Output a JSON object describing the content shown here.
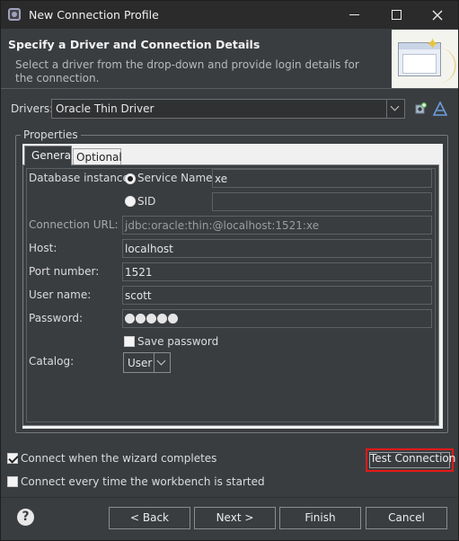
{
  "window": {
    "title": "New Connection Profile"
  },
  "header": {
    "title": "Specify a Driver and Connection Details",
    "description": "Select a driver from the drop-down and provide login details for the connection."
  },
  "drivers": {
    "label": "Drivers:",
    "selected": "Oracle Thin Driver",
    "new_icon": "new-driver-icon",
    "edit_icon": "edit-driver-icon"
  },
  "properties": {
    "legend": "Properties",
    "tabs": [
      {
        "label": "General",
        "active": true
      },
      {
        "label": "Optional",
        "active": false
      }
    ],
    "general": {
      "database_instance_label": "Database instance:",
      "service_name_label": "Service Name",
      "service_name_value": "xe",
      "service_name_selected": true,
      "sid_label": "SID",
      "sid_value": "",
      "connection_url_label": "Connection URL:",
      "connection_url_value": "jdbc:oracle:thin:@localhost:1521:xe",
      "host_label": "Host:",
      "host_value": "localhost",
      "port_label": "Port number:",
      "port_value": "1521",
      "user_label": "User name:",
      "user_value": "scott",
      "password_label": "Password:",
      "password_dots": 5,
      "save_password_label": "Save password",
      "save_password_checked": false,
      "catalog_label": "Catalog:",
      "catalog_value": "User"
    }
  },
  "options": {
    "connect_on_finish_label": "Connect when the wizard completes",
    "connect_on_finish_checked": true,
    "connect_on_startup_label": "Connect every time the workbench is started",
    "connect_on_startup_checked": false
  },
  "buttons": {
    "test_connection": "Test Connection",
    "back": "< Back",
    "next": "Next >",
    "finish": "Finish",
    "cancel": "Cancel",
    "help_icon": "help-icon"
  },
  "colors": {
    "highlight": "#e81818",
    "background": "#3a3d40"
  }
}
